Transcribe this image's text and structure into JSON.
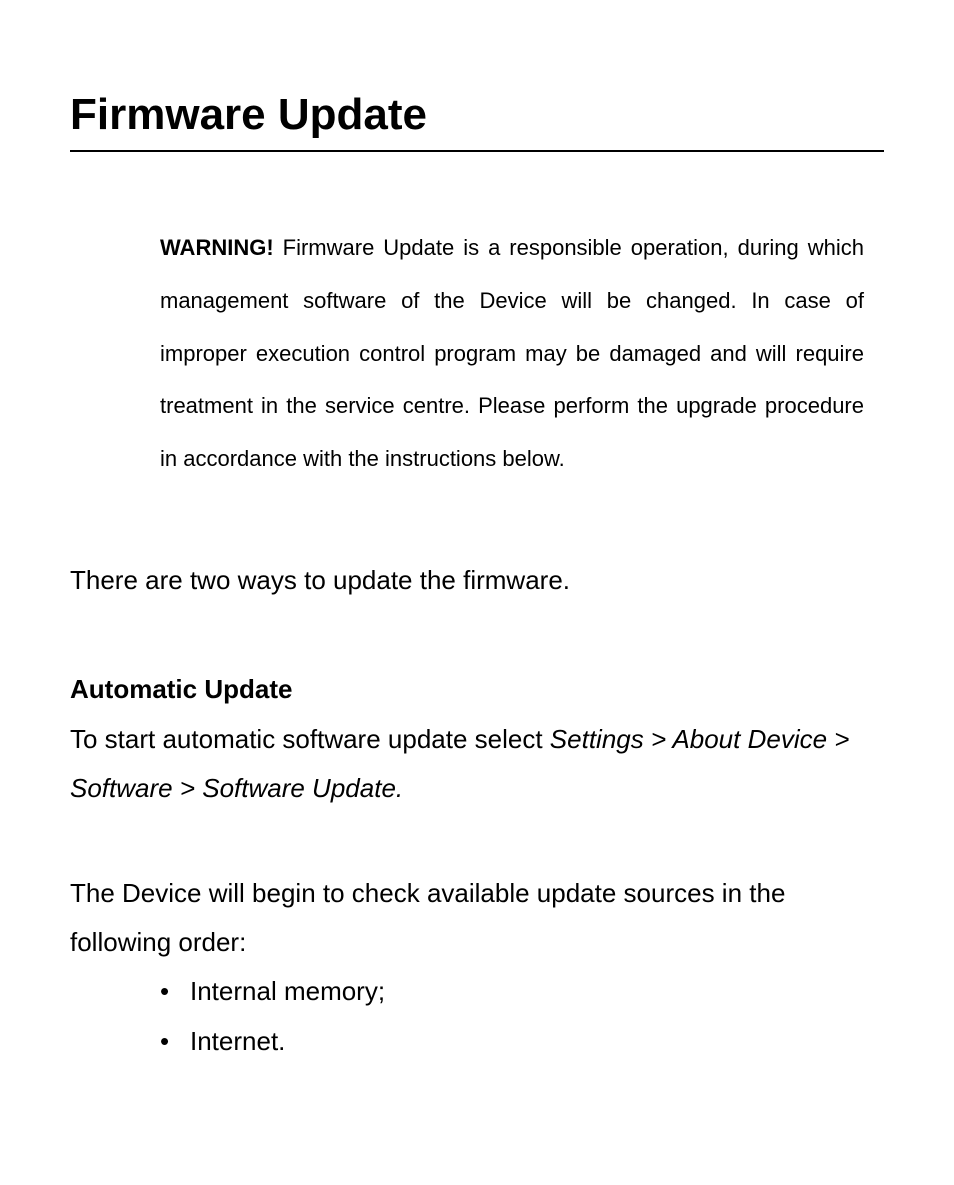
{
  "title": "Firmware Update",
  "warning": {
    "label": "WARNING!",
    "text": " Firmware Update is a responsible operation, during which management software of the Device will be changed. In case of improper execution control program may be damaged and will require treatment in the service centre. Please perform the upgrade procedure in accordance with the instructions below."
  },
  "intro": "There are two ways to update the firmware.",
  "section": {
    "heading": "Automatic Update",
    "lead": "To start automatic software update select ",
    "path": "Settings > About Device > Software > Software Update."
  },
  "check_text": "The Device will begin to check available update sources in the following order:",
  "bullets": {
    "item1": "Internal memory;",
    "item2": "Internet."
  }
}
